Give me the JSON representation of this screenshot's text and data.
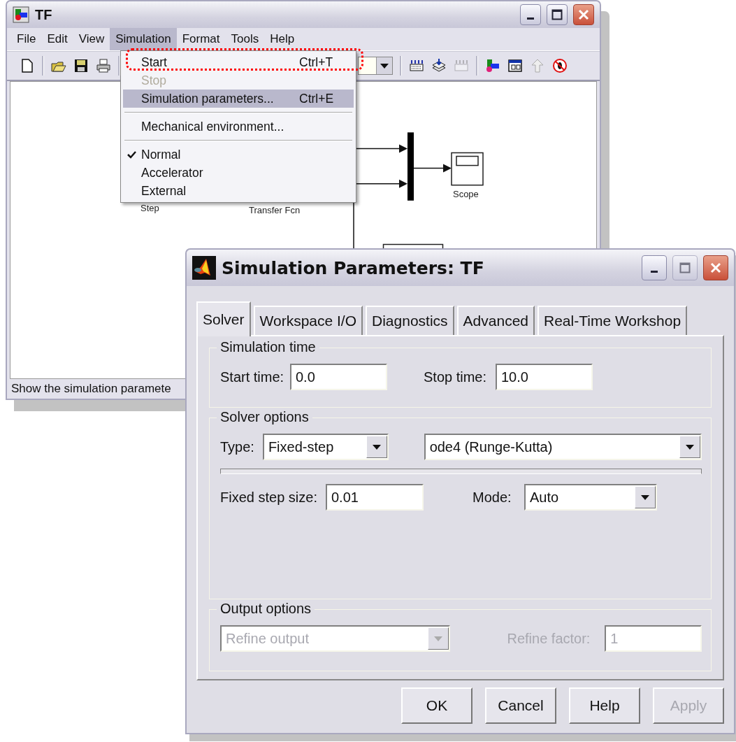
{
  "main_window": {
    "title": "TF",
    "menu": [
      {
        "label": "File",
        "selected": false
      },
      {
        "label": "Edit",
        "selected": false
      },
      {
        "label": "View",
        "selected": false
      },
      {
        "label": "Simulation",
        "selected": true
      },
      {
        "label": "Format",
        "selected": false
      },
      {
        "label": "Tools",
        "selected": false
      },
      {
        "label": "Help",
        "selected": false
      }
    ],
    "diagram": {
      "blocks": [
        {
          "kind": "step",
          "label": "Step"
        },
        {
          "kind": "transfer",
          "label": "Transfer Fcn"
        },
        {
          "kind": "scope",
          "label": "Scope"
        }
      ]
    },
    "status_bar": "Show the simulation paramete"
  },
  "menu_dropdown": [
    {
      "kind": "item",
      "label": "Start",
      "shortcut": "Ctrl+T",
      "disabled": false,
      "selected": false,
      "checked": false
    },
    {
      "kind": "item",
      "label": "Stop",
      "disabled": true,
      "selected": false,
      "checked": false
    },
    {
      "kind": "item",
      "label": "Simulation parameters...",
      "shortcut": "Ctrl+E",
      "disabled": false,
      "selected": true,
      "checked": false
    },
    {
      "kind": "separator"
    },
    {
      "kind": "item",
      "label": "Mechanical environment...",
      "disabled": false,
      "selected": false,
      "checked": false
    },
    {
      "kind": "separator"
    },
    {
      "kind": "item",
      "label": "Normal",
      "disabled": false,
      "selected": false,
      "checked": true
    },
    {
      "kind": "item",
      "label": "Accelerator",
      "disabled": false,
      "selected": false,
      "checked": false
    },
    {
      "kind": "item",
      "label": "External",
      "disabled": false,
      "selected": false,
      "checked": false
    }
  ],
  "dialog": {
    "title": "Simulation Parameters: TF",
    "tabs": [
      {
        "label": "Solver",
        "selected": true
      },
      {
        "label": "Workspace I/O",
        "selected": false
      },
      {
        "label": "Diagnostics",
        "selected": false
      },
      {
        "label": "Advanced",
        "selected": false
      },
      {
        "label": "Real-Time Workshop",
        "selected": false
      }
    ],
    "groups": [
      {
        "title": "Simulation time",
        "items": [
          {
            "kind": "label",
            "text": "Start time:",
            "disabled": false
          },
          {
            "kind": "text",
            "value": "0.0",
            "disabled": false
          },
          {
            "kind": "label",
            "text": "Stop time:",
            "disabled": false
          },
          {
            "kind": "text",
            "value": "10.0",
            "disabled": false
          }
        ]
      },
      {
        "title": "Solver options",
        "items": [
          {
            "kind": "label",
            "text": "Type:",
            "disabled": false
          },
          {
            "kind": "select",
            "value": "Fixed-step",
            "disabled": false
          },
          {
            "kind": "select",
            "value": "ode4 (Runge-Kutta)",
            "disabled": false
          },
          {
            "kind": "rule"
          },
          {
            "kind": "label",
            "text": "Fixed step size:",
            "disabled": false
          },
          {
            "kind": "text",
            "value": "0.01",
            "disabled": false
          },
          {
            "kind": "label",
            "text": "Mode:",
            "disabled": false
          },
          {
            "kind": "select",
            "value": "Auto",
            "disabled": false
          }
        ]
      },
      {
        "title": "Output options",
        "items": [
          {
            "kind": "select",
            "value": "Refine output",
            "disabled": true
          },
          {
            "kind": "label",
            "text": "Refine factor:",
            "disabled": true
          },
          {
            "kind": "text",
            "value": "1",
            "disabled": true
          }
        ]
      }
    ],
    "buttons": [
      {
        "label": "OK",
        "disabled": false
      },
      {
        "label": "Cancel",
        "disabled": false
      },
      {
        "label": "Help",
        "disabled": false
      },
      {
        "label": "Apply",
        "disabled": true
      }
    ]
  }
}
